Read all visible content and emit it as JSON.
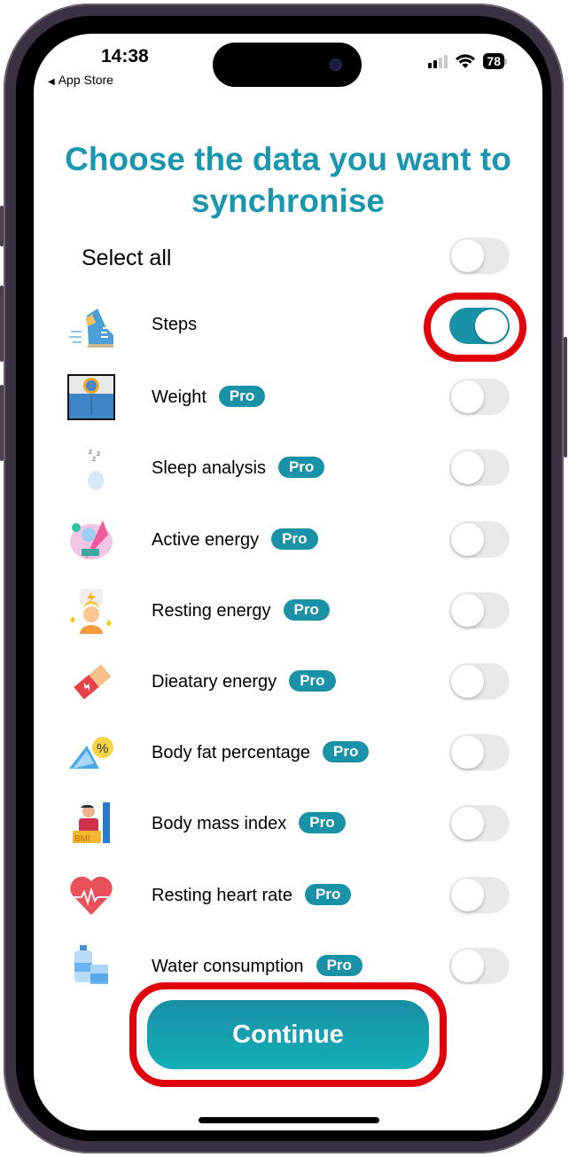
{
  "status_bar": {
    "time": "14:38",
    "back_label": "App Store",
    "battery": "78"
  },
  "title": "Choose the data you want to synchronise",
  "select_all": {
    "label": "Select all",
    "on": false
  },
  "pro_badge": "Pro",
  "items": [
    {
      "label": "Steps",
      "pro": false,
      "on": true,
      "icon": "running-shoe-icon"
    },
    {
      "label": "Weight",
      "pro": true,
      "on": false,
      "icon": "scale-icon"
    },
    {
      "label": "Sleep analysis",
      "pro": true,
      "on": false,
      "icon": "moon-sleep-icon"
    },
    {
      "label": "Active energy",
      "pro": true,
      "on": false,
      "icon": "active-energy-icon"
    },
    {
      "label": "Resting energy",
      "pro": true,
      "on": false,
      "icon": "resting-energy-icon"
    },
    {
      "label": "Dieatary energy",
      "pro": true,
      "on": false,
      "icon": "energy-bar-icon"
    },
    {
      "label": "Body fat percentage",
      "pro": true,
      "on": false,
      "icon": "body-fat-icon"
    },
    {
      "label": "Body mass index",
      "pro": true,
      "on": false,
      "icon": "bmi-icon"
    },
    {
      "label": "Resting heart rate",
      "pro": true,
      "on": false,
      "icon": "heart-rate-icon"
    },
    {
      "label": "Water consumption",
      "pro": true,
      "on": false,
      "icon": "water-icon"
    }
  ],
  "continue_label": "Continue",
  "colors": {
    "accent": "#1992a8",
    "title": "#1a97ae",
    "highlight": "#e0000b"
  }
}
